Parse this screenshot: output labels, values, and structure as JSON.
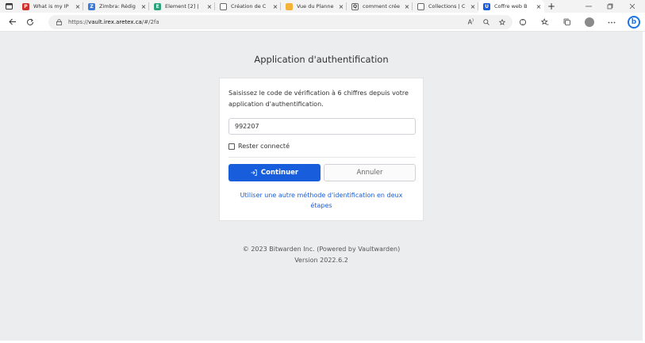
{
  "browser": {
    "tabs": [
      {
        "title": "What is my IP",
        "fav_color": "#d0312d",
        "fav_glyph": "P"
      },
      {
        "title": "Zimbra: Rédig",
        "fav_color": "#3b7bd6",
        "fav_glyph": "Z"
      },
      {
        "title": "Element [2] | ",
        "fav_color": "#2aa37a",
        "fav_glyph": "E"
      },
      {
        "title": "Création de C",
        "fav_color": "#ffffff",
        "fav_glyph": ""
      },
      {
        "title": "Vue du Planne",
        "fav_color": "#f3b23a",
        "fav_glyph": ""
      },
      {
        "title": "comment crée",
        "fav_color": "#ffffff",
        "fav_glyph": "Q"
      },
      {
        "title": "Collections | C",
        "fav_color": "#ffffff",
        "fav_glyph": ""
      },
      {
        "title": "Coffre web B",
        "fav_color": "#175ddc",
        "fav_glyph": "U"
      }
    ],
    "new_tab_glyph": "+",
    "close_glyph": "×",
    "url": "https://vault.irex.aretex.ca/#/2fa",
    "url_prefix": "https://",
    "url_host": "vault.irex.aretex.ca",
    "url_path": "/#/2fa"
  },
  "page": {
    "title": "Application d'authentification",
    "intro": "Saisissez le code de vérification à 6 chiffres depuis votre application d'authentification.",
    "code_value": "992207",
    "remember_label": "Rester connecté",
    "continue_label": "Continuer",
    "cancel_label": "Annuler",
    "alt_method_link": "Utiliser une autre méthode d'identification en deux étapes",
    "footer_copyright": "© 2023 Bitwarden Inc. (Powered by Vaultwarden)",
    "footer_version": "Version 2022.6.2"
  },
  "colors": {
    "primary": "#175ddc",
    "page_bg": "#ecedef"
  }
}
